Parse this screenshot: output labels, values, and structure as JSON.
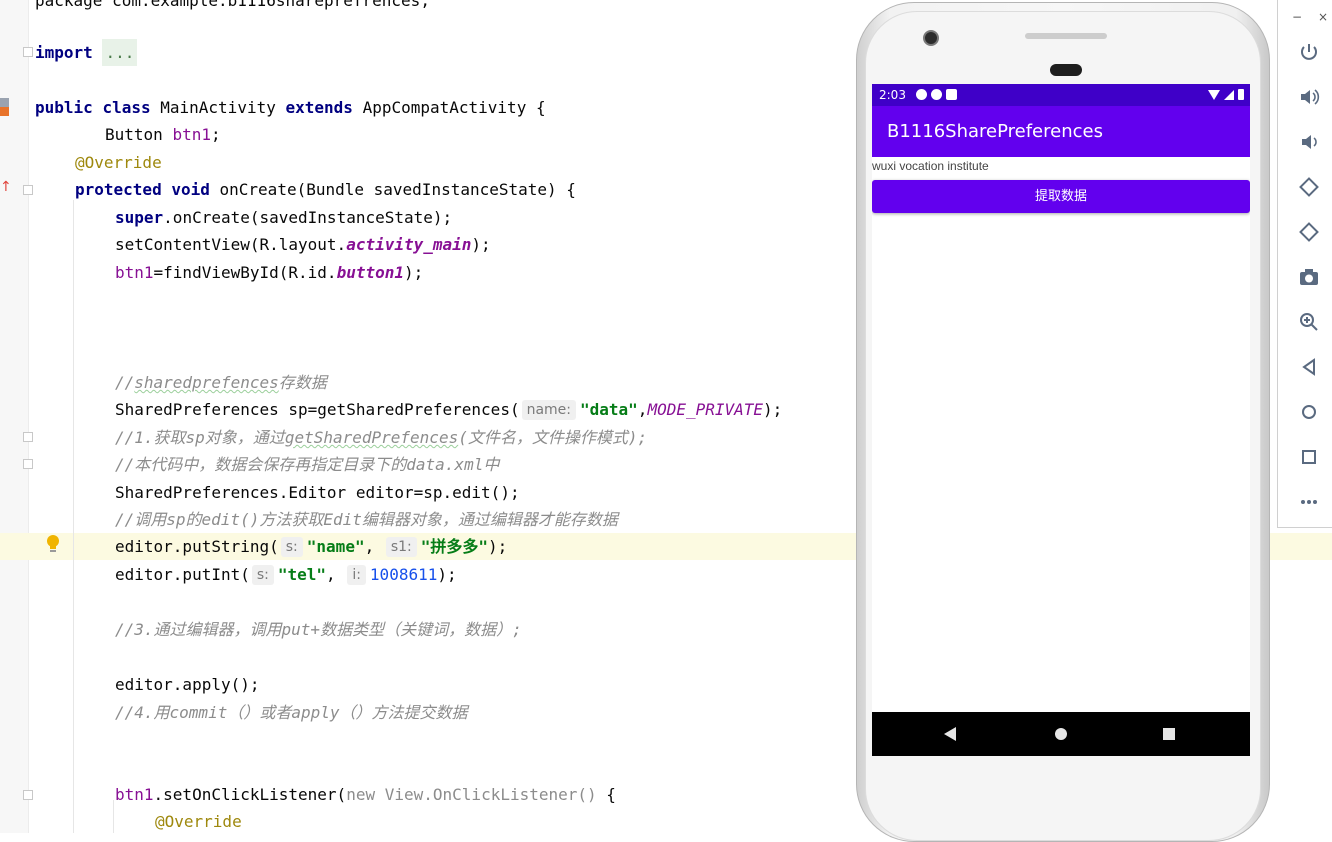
{
  "editor": {
    "lines": {
      "l0": "package com.example.b1116shareprefrences;",
      "import_kw": "import",
      "import_dots": "...",
      "public": "public",
      "class": "class",
      "classname": "MainActivity",
      "extends": "extends",
      "parent": "AppCompatActivity",
      "brace_open": "{",
      "button_type": "Button",
      "btn1_field": "btn1",
      "override": "@Override",
      "protected": "protected",
      "void": "void",
      "oncreate_sig": "onCreate(Bundle savedInstanceState) {",
      "super": "super",
      "super_call": ".onCreate(savedInstanceState);",
      "setcontent_a": "setContentView(R.layout.",
      "activity_main": "activity_main",
      "close_paren": ");",
      "btn1_assign_a": "btn1",
      "btn1_assign_b": "=findViewById(R.id.",
      "button1": "button1",
      "cmt1_a": "//",
      "cmt1_b": "sharedprefences",
      "cmt1_c": "存数据",
      "sp_a": "SharedPreferences sp=getSharedPreferences(",
      "hint_name": "name:",
      "str_data": "\"data\"",
      "comma": ",",
      "mode_private": "MODE_PRIVATE",
      "cmt2_a": "//1.获取sp对象，通过",
      "cmt2_b": "getSharedPrefences",
      "cmt2_c": "(文件名，文件操作模式);",
      "cmt3": "//本代码中，数据会保存再指定目录下的data.xml中",
      "editor_line": "SharedPreferences.Editor editor=sp.edit();",
      "cmt4": "//调用sp的edit()方法获取Edit编辑器对象，通过编辑器才能存数据",
      "putstring_a": "editor.putString(",
      "hint_s": "s:",
      "str_name": "\"name\"",
      "hint_s1": "s1:",
      "str_pdd": "\"拼多多\"",
      "putint_a": "editor.putInt(",
      "str_tel": "\"tel\"",
      "hint_i": "i:",
      "num_tel": "1008611",
      "cmt5": "//3.通过编辑器，调用put+数据类型（关键词，数据）;",
      "apply_line": "editor.apply();",
      "cmt6": "//4.用commit（）或者apply（）方法提交数据",
      "btn1_listen": "btn1",
      "listen_b": ".setOnClickListener(",
      "new_kw": "new",
      "view_listener": "View.OnClickListener()",
      "brace_open2": "{",
      "override2": "@Override"
    }
  },
  "emulator": {
    "status_time": "2:03",
    "app_title": "B1116SharePreferences",
    "body_text": "wuxi vocation institute",
    "button_label": "提取数据"
  },
  "toolbar": {
    "minimize": "−",
    "close": "×",
    "icons": [
      "power-icon",
      "volume-up-icon",
      "volume-down-icon",
      "rotate-left-icon",
      "rotate-right-icon",
      "camera-icon",
      "zoom-icon",
      "back-icon",
      "home-icon",
      "overview-icon",
      "more-icon"
    ]
  },
  "colors": {
    "app_bar": "#6200ee",
    "status_bar": "#3f00c8",
    "keyword": "#0033b3",
    "string": "#067d17",
    "comment": "#8c8c8c",
    "highlight_line": "#fcfae1"
  }
}
